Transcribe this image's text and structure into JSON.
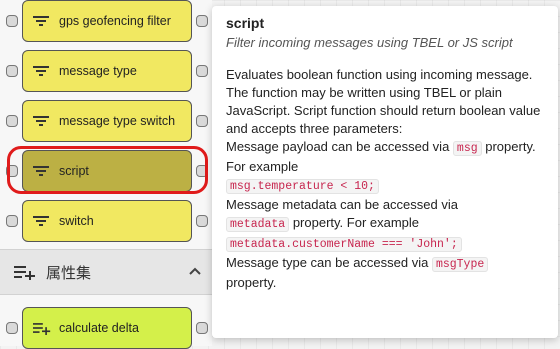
{
  "palette": {
    "nodes": [
      {
        "label": "gps geofencing filter",
        "icon": "filter-icon"
      },
      {
        "label": "message type",
        "icon": "filter-icon"
      },
      {
        "label": "message type switch",
        "icon": "filter-icon"
      },
      {
        "label": "script",
        "icon": "filter-icon",
        "selected": true
      },
      {
        "label": "switch",
        "icon": "filter-icon"
      }
    ],
    "section": {
      "title": "属性集",
      "icon": "playlist-add-icon",
      "chevron": "chevron-up-icon"
    },
    "section_nodes": [
      {
        "label": "calculate delta",
        "icon": "playlist-add-icon"
      }
    ],
    "colors": {
      "filter_node": "#f1e861",
      "selected_node": "#bcb044",
      "enrichment_node": "#d4f04a",
      "highlight": "#e01b1b"
    }
  },
  "tooltip": {
    "title": "script",
    "subtitle": "Filter incoming messages using TBEL or JS script",
    "body": {
      "intro": "Evaluates boolean function using incoming message. The function may be written using TBEL or plain JavaScript. Script function should return boolean value and accepts three parameters:",
      "payload_pre": "Message payload can be accessed via ",
      "payload_code": "msg",
      "payload_post": " property. For example",
      "payload_example": "msg.temperature < 10;",
      "metadata_pre": "Message metadata can be accessed via",
      "metadata_code": "metadata",
      "metadata_post": " property. For example",
      "metadata_example": "metadata.customerName === 'John';",
      "type_pre": "Message type can be accessed via ",
      "type_code": "msgType",
      "type_post": "property."
    }
  }
}
